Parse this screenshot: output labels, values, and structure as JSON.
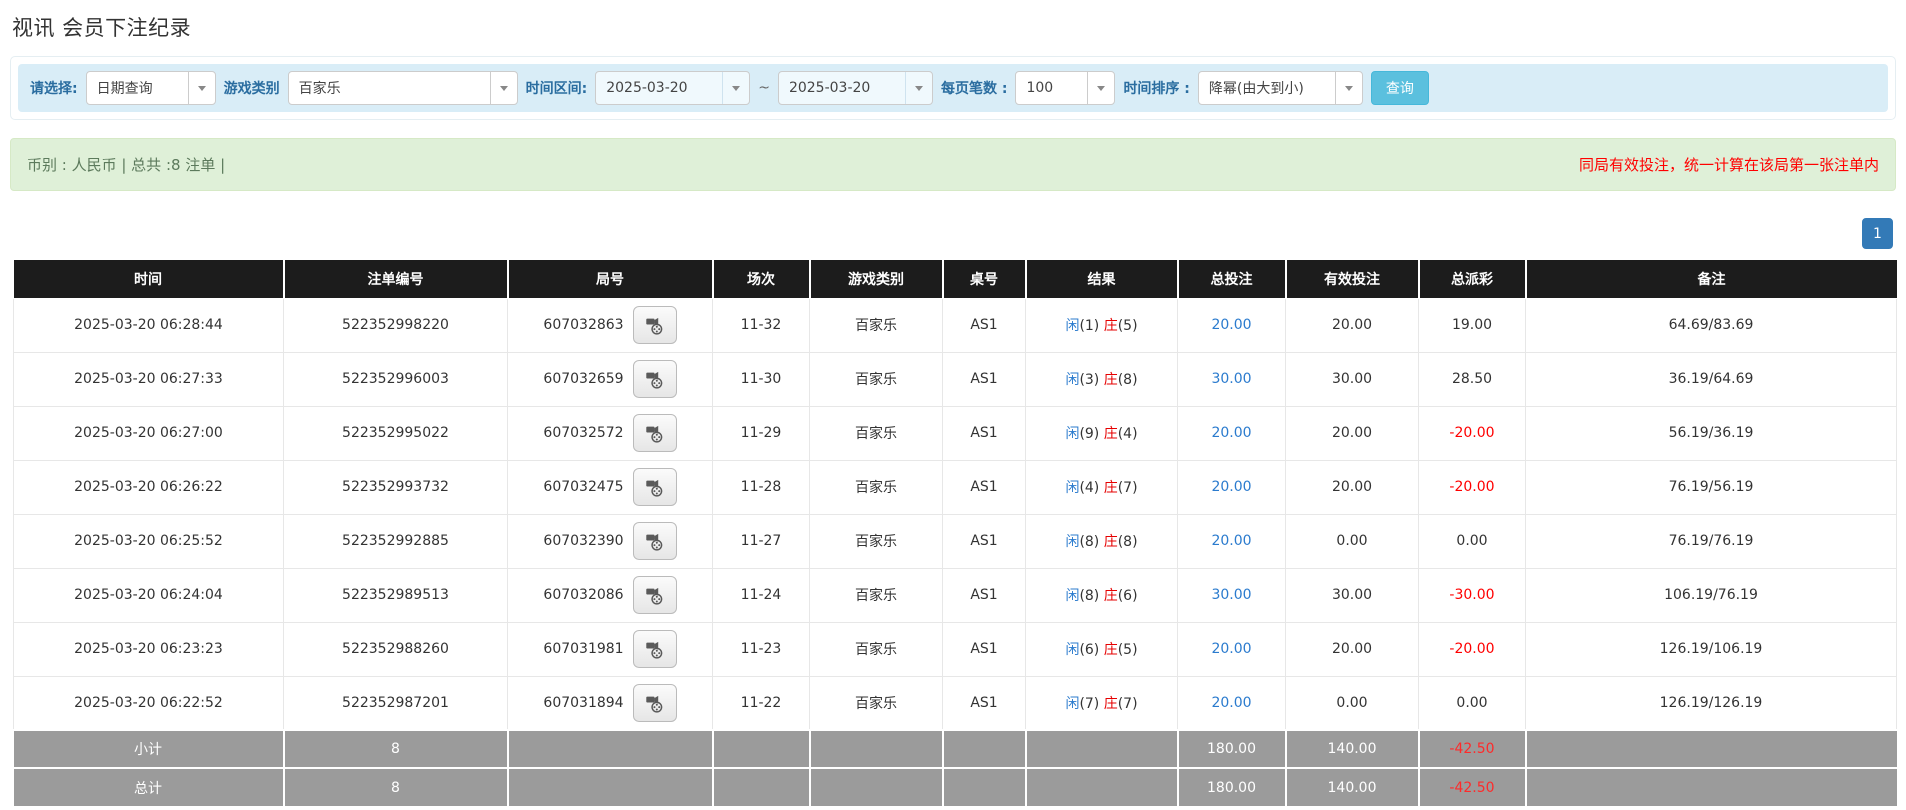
{
  "page_title": "视讯 会员下注纪录",
  "filters": {
    "select_label": "请选择:",
    "select_value": "日期查询",
    "game_type_label": "游戏类别",
    "game_type_value": "百家乐",
    "time_range_label": "时间区间:",
    "date_from": "2025-03-20",
    "tilde": "~",
    "date_to": "2025-03-20",
    "page_size_label": "每页笔数 :",
    "page_size_value": "100",
    "sort_label": "时间排序 :",
    "sort_value": "降幂(由大到小)",
    "search_button": "查询"
  },
  "summary_bar": {
    "left_text": "币别 : 人民币 | 总共 :8 注单 |",
    "right_text": "同局有效投注，统一计算在该局第一张注单内"
  },
  "pagination": {
    "current_page": "1"
  },
  "icons": {
    "video_button": "video-file-icon",
    "dropdown": "chevron-down-icon"
  },
  "colors": {
    "filter_bg": "#d9edf7",
    "summary_bg": "#dff0d8",
    "header_bg": "#1c1c1c",
    "footer_bg": "#9b9b9b",
    "accent_blue": "#2b7bce",
    "banker_red": "#e60000",
    "negative_red": "#ff0000",
    "query_button": "#5bc0de",
    "pager_active": "#337ab7"
  },
  "table": {
    "headers": [
      "时间",
      "注单编号",
      "局号",
      "场次",
      "游戏类别",
      "桌号",
      "结果",
      "总投注",
      "有效投注",
      "总派彩",
      "备注"
    ],
    "rows": [
      {
        "time": "2025-03-20 06:28:44",
        "bet_id": "522352998220",
        "round_id": "607032863",
        "session": "11-32",
        "game": "百家乐",
        "table_id": "AS1",
        "result_player_label": "闲",
        "result_player_value": "(1)",
        "result_banker_label": "庄",
        "result_banker_value": "(5)",
        "total_bet": "20.00",
        "valid_bet": "20.00",
        "payout": "19.00",
        "remark": "64.69/83.69"
      },
      {
        "time": "2025-03-20 06:27:33",
        "bet_id": "522352996003",
        "round_id": "607032659",
        "session": "11-30",
        "game": "百家乐",
        "table_id": "AS1",
        "result_player_label": "闲",
        "result_player_value": "(3)",
        "result_banker_label": "庄",
        "result_banker_value": "(8)",
        "total_bet": "30.00",
        "valid_bet": "30.00",
        "payout": "28.50",
        "remark": "36.19/64.69"
      },
      {
        "time": "2025-03-20 06:27:00",
        "bet_id": "522352995022",
        "round_id": "607032572",
        "session": "11-29",
        "game": "百家乐",
        "table_id": "AS1",
        "result_player_label": "闲",
        "result_player_value": "(9)",
        "result_banker_label": "庄",
        "result_banker_value": "(4)",
        "total_bet": "20.00",
        "valid_bet": "20.00",
        "payout": "-20.00",
        "remark": "56.19/36.19"
      },
      {
        "time": "2025-03-20 06:26:22",
        "bet_id": "522352993732",
        "round_id": "607032475",
        "session": "11-28",
        "game": "百家乐",
        "table_id": "AS1",
        "result_player_label": "闲",
        "result_player_value": "(4)",
        "result_banker_label": "庄",
        "result_banker_value": "(7)",
        "total_bet": "20.00",
        "valid_bet": "20.00",
        "payout": "-20.00",
        "remark": "76.19/56.19"
      },
      {
        "time": "2025-03-20 06:25:52",
        "bet_id": "522352992885",
        "round_id": "607032390",
        "session": "11-27",
        "game": "百家乐",
        "table_id": "AS1",
        "result_player_label": "闲",
        "result_player_value": "(8)",
        "result_banker_label": "庄",
        "result_banker_value": "(8)",
        "total_bet": "20.00",
        "valid_bet": "0.00",
        "payout": "0.00",
        "remark": "76.19/76.19"
      },
      {
        "time": "2025-03-20 06:24:04",
        "bet_id": "522352989513",
        "round_id": "607032086",
        "session": "11-24",
        "game": "百家乐",
        "table_id": "AS1",
        "result_player_label": "闲",
        "result_player_value": "(8)",
        "result_banker_label": "庄",
        "result_banker_value": "(6)",
        "total_bet": "30.00",
        "valid_bet": "30.00",
        "payout": "-30.00",
        "remark": "106.19/76.19"
      },
      {
        "time": "2025-03-20 06:23:23",
        "bet_id": "522352988260",
        "round_id": "607031981",
        "session": "11-23",
        "game": "百家乐",
        "table_id": "AS1",
        "result_player_label": "闲",
        "result_player_value": "(6)",
        "result_banker_label": "庄",
        "result_banker_value": "(5)",
        "total_bet": "20.00",
        "valid_bet": "20.00",
        "payout": "-20.00",
        "remark": "126.19/106.19"
      },
      {
        "time": "2025-03-20 06:22:52",
        "bet_id": "522352987201",
        "round_id": "607031894",
        "session": "11-22",
        "game": "百家乐",
        "table_id": "AS1",
        "result_player_label": "闲",
        "result_player_value": "(7)",
        "result_banker_label": "庄",
        "result_banker_value": "(7)",
        "total_bet": "20.00",
        "valid_bet": "0.00",
        "payout": "0.00",
        "remark": "126.19/126.19"
      }
    ],
    "footer": [
      {
        "label": "小计",
        "count": "8",
        "total_bet": "180.00",
        "valid_bet": "140.00",
        "payout": "-42.50"
      },
      {
        "label": "总计",
        "count": "8",
        "total_bet": "180.00",
        "valid_bet": "140.00",
        "payout": "-42.50"
      }
    ]
  }
}
